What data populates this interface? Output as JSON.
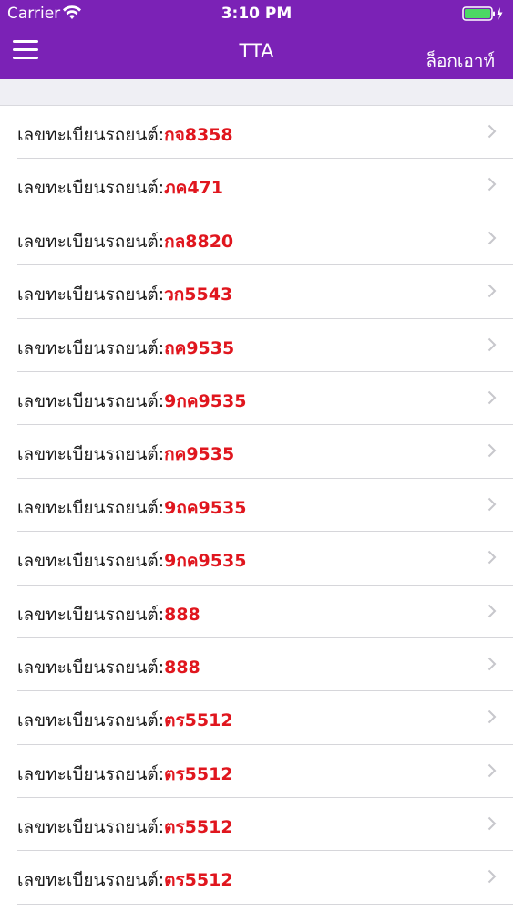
{
  "status_bar": {
    "carrier": "Carrier",
    "time": "3:10 PM"
  },
  "nav": {
    "title": "TTA",
    "logout_label": "ล็อกเอาท์"
  },
  "colors": {
    "nav_background": "#7b22b6",
    "plate_text": "#e0161e",
    "battery": "#4cd964"
  },
  "plate_rows": [
    {
      "label": "เลขทะเบียนรถยนต์:",
      "plate": "กจ8358"
    },
    {
      "label": "เลขทะเบียนรถยนต์:",
      "plate": "ภค471"
    },
    {
      "label": "เลขทะเบียนรถยนต์:",
      "plate": "กล8820"
    },
    {
      "label": "เลขทะเบียนรถยนต์:",
      "plate": "วก5543"
    },
    {
      "label": "เลขทะเบียนรถยนต์:",
      "plate": "ถค9535"
    },
    {
      "label": "เลขทะเบียนรถยนต์:",
      "plate": "9กค9535"
    },
    {
      "label": "เลขทะเบียนรถยนต์:",
      "plate": "กค9535"
    },
    {
      "label": "เลขทะเบียนรถยนต์:",
      "plate": "9ถค9535"
    },
    {
      "label": "เลขทะเบียนรถยนต์:",
      "plate": "9กค9535"
    },
    {
      "label": "เลขทะเบียนรถยนต์:",
      "plate": "888"
    },
    {
      "label": "เลขทะเบียนรถยนต์:",
      "plate": "888"
    },
    {
      "label": "เลขทะเบียนรถยนต์:",
      "plate": "ตร5512"
    },
    {
      "label": "เลขทะเบียนรถยนต์:",
      "plate": "ตร5512"
    },
    {
      "label": "เลขทะเบียนรถยนต์:",
      "plate": "ตร5512"
    },
    {
      "label": "เลขทะเบียนรถยนต์:",
      "plate": "ตร5512"
    }
  ],
  "icons": {
    "menu": "hamburger-menu-icon",
    "row_disclosure": "chevron-right-icon"
  }
}
